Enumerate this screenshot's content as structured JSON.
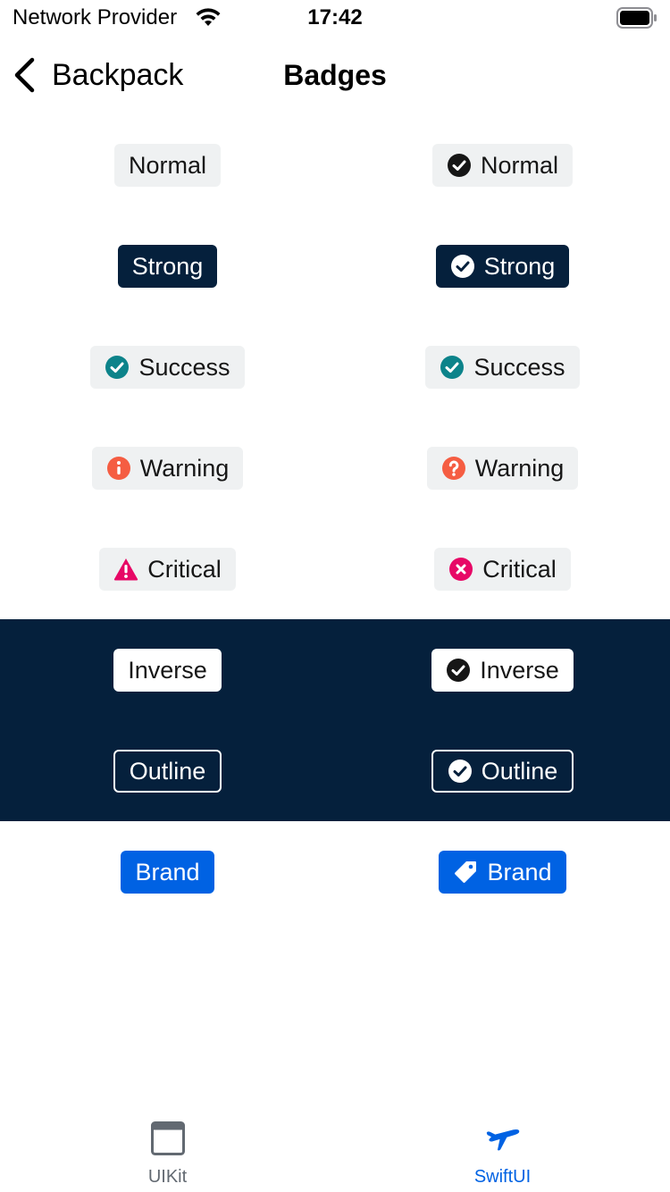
{
  "status_bar": {
    "carrier": "Network Provider",
    "time": "17:42",
    "wifi_icon": "wifi-icon",
    "battery_icon": "battery-full-icon"
  },
  "nav": {
    "back_label": "Backpack",
    "back_icon": "chevron-left-icon",
    "title": "Badges"
  },
  "badges": {
    "normal": {
      "left": "Normal",
      "right": "Normal",
      "right_icon": "tick-circle-icon"
    },
    "strong": {
      "left": "Strong",
      "right": "Strong",
      "right_icon": "tick-circle-icon"
    },
    "success": {
      "left": "Success",
      "right": "Success",
      "left_icon": "tick-circle-icon",
      "right_icon": "tick-circle-icon"
    },
    "warning": {
      "left": "Warning",
      "right": "Warning",
      "left_icon": "information-circle-icon",
      "right_icon": "help-circle-icon"
    },
    "critical": {
      "left": "Critical",
      "right": "Critical",
      "left_icon": "exclamation-triangle-icon",
      "right_icon": "close-circle-icon"
    },
    "inverse": {
      "left": "Inverse",
      "right": "Inverse",
      "right_icon": "tick-circle-icon"
    },
    "outline": {
      "left": "Outline",
      "right": "Outline",
      "right_icon": "tick-circle-icon"
    },
    "brand": {
      "left": "Brand",
      "right": "Brand",
      "right_icon": "price-tag-icon"
    }
  },
  "tabs": [
    {
      "label": "UIKit",
      "icon": "window-icon",
      "selected": false
    },
    {
      "label": "SwiftUI",
      "icon": "airplane-icon",
      "selected": true
    }
  ],
  "colors": {
    "brand_dark": "#05203c",
    "brand_blue": "#0062e3",
    "success": "#0c838a",
    "warning": "#f55d42",
    "critical": "#e70866",
    "badge_bg": "#eff1f2"
  }
}
